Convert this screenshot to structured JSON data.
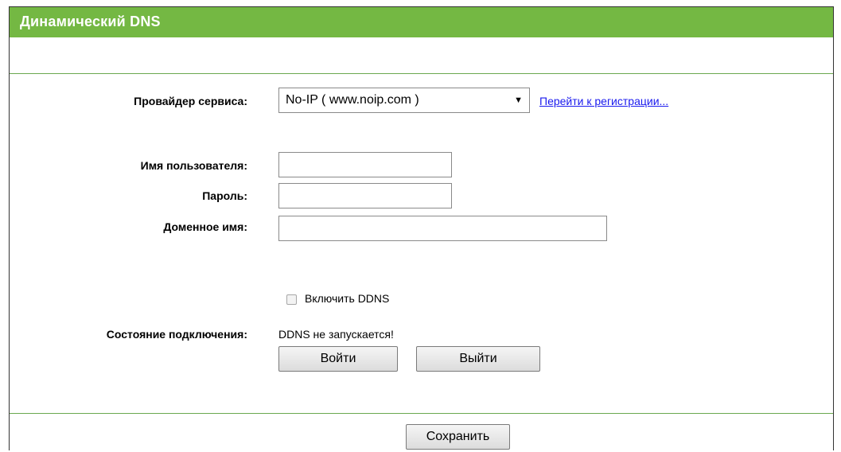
{
  "header": {
    "title": "Динамический DNS"
  },
  "form": {
    "provider_label": "Провайдер сервиса:",
    "provider_value": "No-IP ( www.noip.com )",
    "register_link": "Перейти к регистрации...",
    "username_label": "Имя пользователя:",
    "username_value": "",
    "password_label": "Пароль:",
    "password_value": "",
    "domain_label": "Доменное имя:",
    "domain_value": "",
    "enable_ddns_label": "Включить DDNS",
    "enable_ddns_checked": false,
    "status_label": "Состояние подключения:",
    "status_value": "DDNS не запускается!",
    "login_button": "Войти",
    "logout_button": "Выйти"
  },
  "footer": {
    "save_button": "Сохранить"
  },
  "colors": {
    "header_bg": "#74b843",
    "divider": "#6aa84f",
    "link": "#1a1aee"
  }
}
